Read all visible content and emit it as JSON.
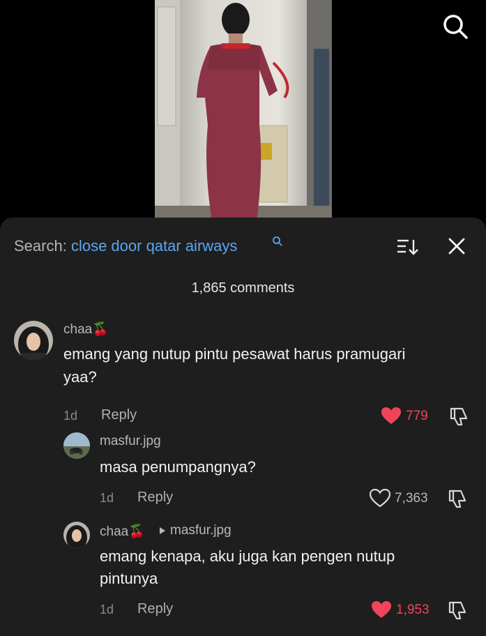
{
  "search": {
    "label": "Search:",
    "query": "close door qatar airways"
  },
  "comments_count": "1,865 comments",
  "comments": [
    {
      "user": "chaa🍒",
      "text_line1": "emang yang nutup pintu pesawat harus pramugari",
      "text_line2": "yaa?",
      "time": "1d",
      "reply": "Reply",
      "likes": "779",
      "liked": true
    },
    {
      "user": "masfur.jpg",
      "text_line1": "masa penumpangnya?",
      "time": "1d",
      "reply": "Reply",
      "likes": "7,363",
      "liked": false
    },
    {
      "user": "chaa🍒",
      "reply_to": "masfur.jpg",
      "text_line1": "emang kenapa, aku juga kan pengen nutup",
      "text_line2": "pintunya",
      "time": "1d",
      "reply": "Reply",
      "likes": "1,953",
      "liked": true
    }
  ],
  "icons": {
    "search": "search-icon",
    "sort": "sort-icon",
    "close": "close-icon",
    "heart": "heart-icon",
    "dislike": "thumbs-down-icon"
  },
  "colors": {
    "accent": "#5aa6f2",
    "liked": "#f0445a",
    "sheet": "#1e1e1e"
  }
}
